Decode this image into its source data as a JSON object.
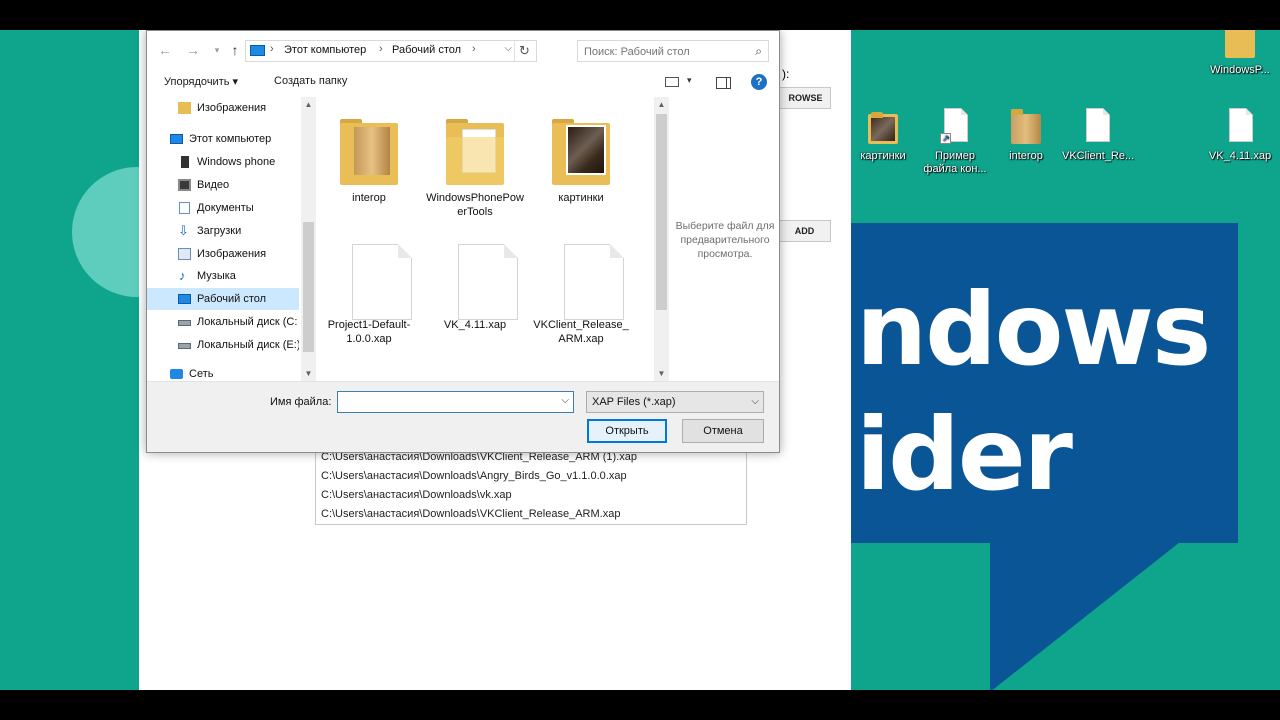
{
  "desktop": {
    "banner_line1": "ndows",
    "banner_line2": "ider",
    "icons": [
      {
        "label": "WindowsP...",
        "kind": "folder"
      },
      {
        "label": "картинки",
        "kind": "folder-photo"
      },
      {
        "label": "Пример файла кон...",
        "kind": "shortcut"
      },
      {
        "label": "interop",
        "kind": "folder-box"
      },
      {
        "label": "VKClient_Re...",
        "kind": "file"
      },
      {
        "label": "VK_4.11.xap",
        "kind": "file"
      }
    ]
  },
  "app": {
    "label_fragment": "):",
    "browse_label": "ROWSE",
    "add_label": "ADD",
    "recent_paths": [
      "C:\\Users\\анастасия\\Downloads\\VKClient_Release_ARM (1).xap",
      "C:\\Users\\анастасия\\Downloads\\Angry_Birds_Go_v1.1.0.0.xap",
      "C:\\Users\\анастасия\\Downloads\\vk.xap",
      "C:\\Users\\анастасия\\Downloads\\VKClient_Release_ARM.xap"
    ]
  },
  "dialog": {
    "address": {
      "crumbs": [
        "Этот компьютер",
        "Рабочий стол"
      ],
      "sep": "›"
    },
    "search_placeholder": "Поиск: Рабочий стол",
    "toolbar": {
      "organize": "Упорядочить ▾",
      "new_folder": "Создать папку",
      "help": "?"
    },
    "nav_items": [
      {
        "label": "Изображения",
        "icon": "folder"
      },
      {
        "label": "Этот компьютер",
        "icon": "pc"
      },
      {
        "label": "Windows phone",
        "icon": "phone"
      },
      {
        "label": "Видео",
        "icon": "video"
      },
      {
        "label": "Документы",
        "icon": "docs"
      },
      {
        "label": "Загрузки",
        "icon": "down"
      },
      {
        "label": "Изображения",
        "icon": "images"
      },
      {
        "label": "Музыка",
        "icon": "music"
      },
      {
        "label": "Рабочий стол",
        "icon": "desk",
        "selected": true
      },
      {
        "label": "Локальный диск (C:",
        "icon": "disk"
      },
      {
        "label": "Локальный диск (E:)",
        "icon": "disk"
      },
      {
        "label": "Сеть",
        "icon": "net"
      }
    ],
    "files": [
      {
        "label": "interop",
        "kind": "folder-box"
      },
      {
        "label": "WindowsPhonePowerTools",
        "kind": "folder-paper"
      },
      {
        "label": "картинки",
        "kind": "folder-photo"
      },
      {
        "label": "Project1-Default-1.0.0.xap",
        "kind": "file"
      },
      {
        "label": "VK_4.11.xap",
        "kind": "file"
      },
      {
        "label": "VKClient_Release_ARM.xap",
        "kind": "file"
      }
    ],
    "preview_text": "Выберите файл для предварительного просмотра.",
    "filename_label": "Имя файла:",
    "filename_value": "",
    "filetype": "XAP Files (*.xap)",
    "open_label": "Открыть",
    "cancel_label": "Отмена",
    "icons": {
      "back": "←",
      "forward": "→",
      "dropdown": "▾",
      "up": "↑",
      "refresh": "↻",
      "search": "⌕",
      "chev": "⌵",
      "scroll_up": "▲",
      "scroll_down": "▼",
      "expand": "›",
      "download_arrow": "⇩",
      "music_note": "♪"
    }
  },
  "colors": {
    "desktop": "#0fa58d",
    "banner": "#0a5596",
    "accent": "#0078d7",
    "selection": "#cce8ff"
  }
}
